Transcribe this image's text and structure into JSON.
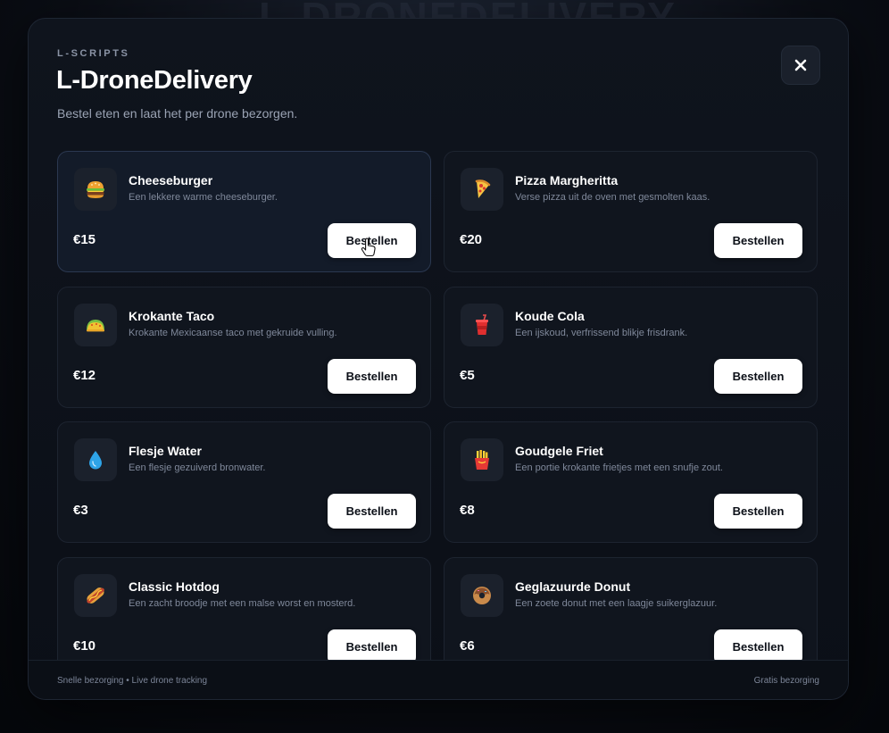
{
  "backdrop": {
    "ghost_title": "L-DRONEDELIVERY"
  },
  "header": {
    "brand": "L-SCRIPTS",
    "title": "L-DroneDelivery",
    "subtitle": "Bestel eten en laat het per drone bezorgen.",
    "close_icon": "close-icon"
  },
  "items": [
    {
      "name": "Cheeseburger",
      "description": "Een lekkere warme cheeseburger.",
      "price": "€15",
      "button": "Bestellen",
      "icon": "burger-icon"
    },
    {
      "name": "Pizza Margheritta",
      "description": "Verse pizza uit de oven met gesmolten kaas.",
      "price": "€20",
      "button": "Bestellen",
      "icon": "pizza-icon"
    },
    {
      "name": "Krokante Taco",
      "description": "Krokante Mexicaanse taco met gekruide vulling.",
      "price": "€12",
      "button": "Bestellen",
      "icon": "taco-icon"
    },
    {
      "name": "Koude Cola",
      "description": "Een ijskoud, verfrissend blikje frisdrank.",
      "price": "€5",
      "button": "Bestellen",
      "icon": "cola-icon"
    },
    {
      "name": "Flesje Water",
      "description": "Een flesje gezuiverd bronwater.",
      "price": "€3",
      "button": "Bestellen",
      "icon": "water-drop-icon"
    },
    {
      "name": "Goudgele Friet",
      "description": "Een portie krokante frietjes met een snufje zout.",
      "price": "€8",
      "button": "Bestellen",
      "icon": "fries-icon"
    },
    {
      "name": "Classic Hotdog",
      "description": "Een zacht broodje met een malse worst en mosterd.",
      "price": "€10",
      "button": "Bestellen",
      "icon": "hotdog-icon"
    },
    {
      "name": "Geglazuurde Donut",
      "description": "Een zoete donut met een laagje suikerglazuur.",
      "price": "€6",
      "button": "Bestellen",
      "icon": "donut-icon"
    }
  ],
  "footer": {
    "left": "Snelle bezorging • Live drone tracking",
    "right": "Gratis bezorging"
  },
  "colors": {
    "background": "#070a10",
    "modal": "#0f141d",
    "card": "#10151e",
    "button": "#ffffff",
    "text": "#ffffff",
    "muted": "#7f889a"
  }
}
